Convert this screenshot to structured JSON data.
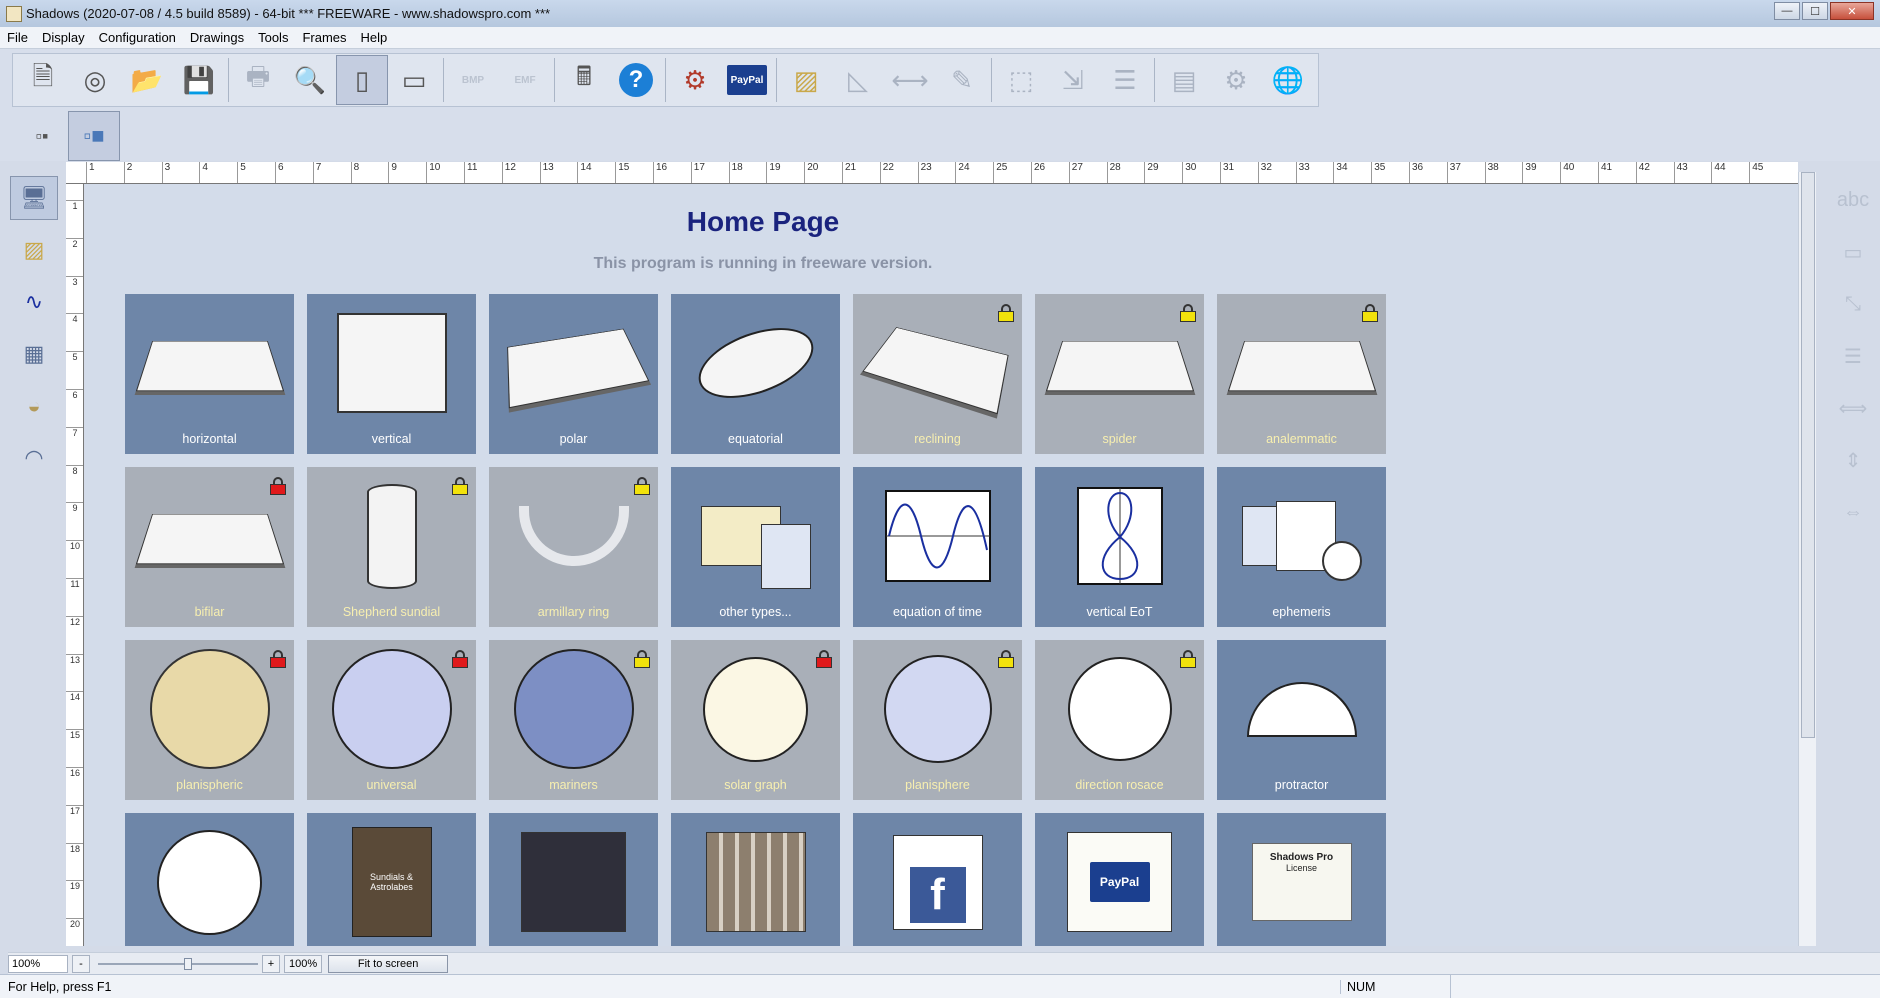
{
  "window": {
    "title": "Shadows (2020-07-08 / 4.5 build 8589) - 64-bit    *** FREEWARE - www.shadowspro.com ***",
    "minimize_glyph": "—",
    "maximize_glyph": "☐",
    "close_glyph": "✕"
  },
  "menu": [
    "File",
    "Display",
    "Configuration",
    "Drawings",
    "Tools",
    "Frames",
    "Help"
  ],
  "toolbar": {
    "bmp_label": "BMP",
    "emf_label": "EMF",
    "help_glyph": "?",
    "paypal_label": "PayPal"
  },
  "page": {
    "title": "Home Page",
    "subtitle": "This program is running in freeware version."
  },
  "tiles": [
    {
      "label": "horizontal",
      "lock": "none"
    },
    {
      "label": "vertical",
      "lock": "none"
    },
    {
      "label": "polar",
      "lock": "none"
    },
    {
      "label": "equatorial",
      "lock": "none"
    },
    {
      "label": "reclining",
      "lock": "yellow"
    },
    {
      "label": "spider",
      "lock": "yellow"
    },
    {
      "label": "analemmatic",
      "lock": "yellow"
    },
    {
      "label": "bifilar",
      "lock": "red"
    },
    {
      "label": "Shepherd sundial",
      "lock": "yellow"
    },
    {
      "label": "armillary ring",
      "lock": "yellow"
    },
    {
      "label": "other types...",
      "lock": "none"
    },
    {
      "label": "equation of time",
      "lock": "none"
    },
    {
      "label": "vertical EoT",
      "lock": "none"
    },
    {
      "label": "ephemeris",
      "lock": "none"
    },
    {
      "label": "planispheric",
      "lock": "red"
    },
    {
      "label": "universal",
      "lock": "red"
    },
    {
      "label": "mariners",
      "lock": "yellow"
    },
    {
      "label": "solar graph",
      "lock": "red"
    },
    {
      "label": "planisphere",
      "lock": "yellow"
    },
    {
      "label": "direction rosace",
      "lock": "yellow"
    },
    {
      "label": "protractor",
      "lock": "none"
    }
  ],
  "bottom_tiles": {
    "book_text": "Sundials & Astrolabes",
    "facebook_glyph": "f",
    "paypal_text": "PayPal",
    "license_title": "Shadows Pro",
    "license_sub": "License"
  },
  "zoom_bar": {
    "zoom_value": "100%",
    "minus": "-",
    "plus": "+",
    "zoom_display": "100%",
    "fit_label": "Fit to screen"
  },
  "status": {
    "help_text": "For Help, press F1",
    "num": "NUM"
  },
  "colors": {
    "tile_active": "#6e86a8",
    "tile_locked": "#a9afb8",
    "title_color": "#1a237e",
    "lock_yellow": "#f2e20c",
    "lock_red": "#e0191b"
  }
}
